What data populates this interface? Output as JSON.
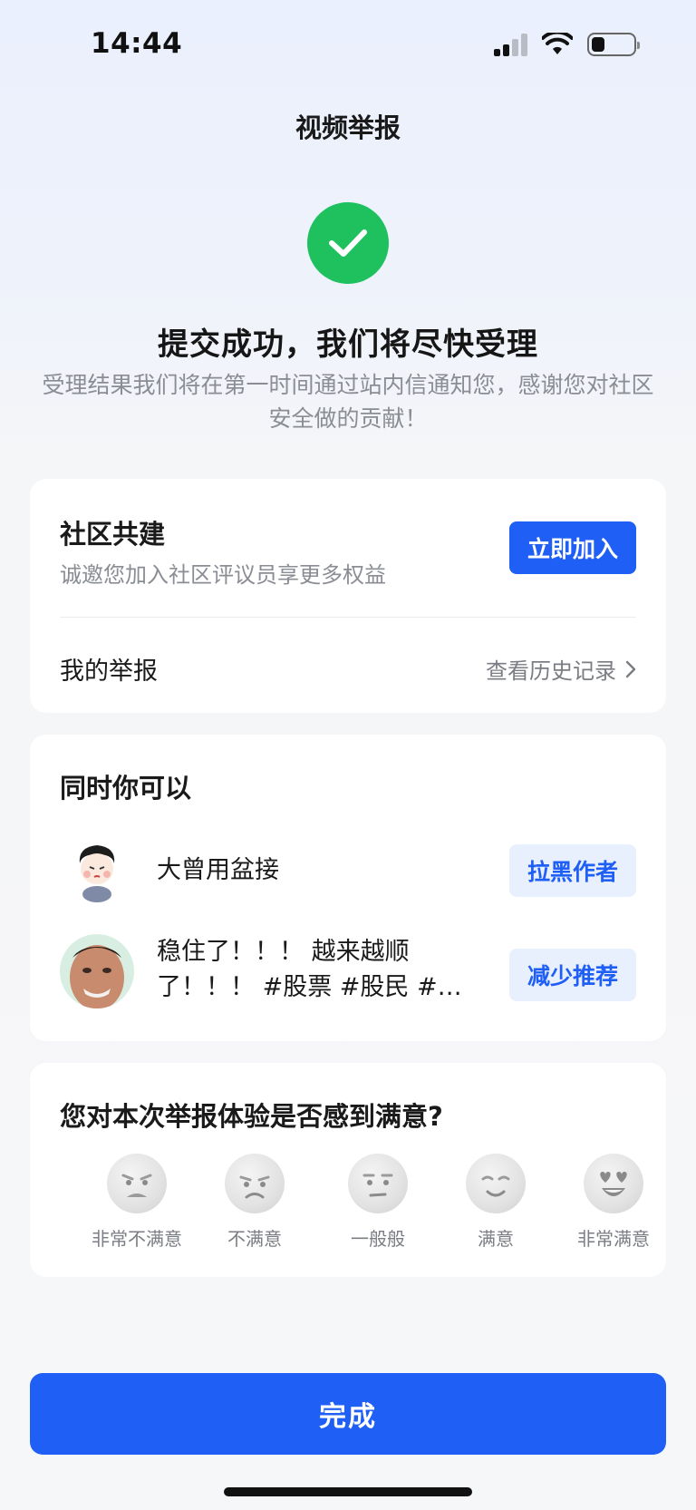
{
  "status_bar": {
    "time": "14:44"
  },
  "header": {
    "title": "视频举报"
  },
  "success": {
    "headline": "提交成功，我们将尽快受理",
    "subtext": "受理结果我们将在第一时间通过站内信通知您，感谢您对社区安全做的贡献！",
    "icon": "check-circle-icon",
    "color": "#1fc15e"
  },
  "community": {
    "title": "社区共建",
    "desc": "诚邀您加入社区评议员享更多权益",
    "join_label": "立即加入",
    "my_report_label": "我的举报",
    "history_label": "查看历史记录"
  },
  "alternatives": {
    "title": "同时你可以",
    "rows": [
      {
        "text": "大曾用盆接",
        "action": "拉黑作者"
      },
      {
        "text": "稳住了！！！  越来越顺了！！！  #股票 #股民 #…",
        "action": "减少推荐"
      }
    ]
  },
  "rating": {
    "title": "您对本次举报体验是否感到满意?",
    "options": [
      "非常不满意",
      "不满意",
      "一般般",
      "满意",
      "非常满意"
    ]
  },
  "footer": {
    "done_label": "完成"
  },
  "colors": {
    "primary": "#1f5ff5",
    "chip_bg": "#e8effd",
    "success": "#1fc15e"
  }
}
